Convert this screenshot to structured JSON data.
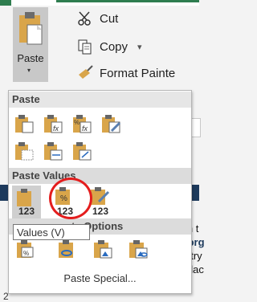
{
  "ribbon": {
    "paste_label": "Paste",
    "cut_label": "Cut",
    "copy_label": "Copy",
    "copy_caret": "▾",
    "format_painter_label": "Format Painte",
    "paste_arrow": "▾"
  },
  "background": {
    "lines": [
      "in t",
      ".org",
      "ntry",
      "ulac"
    ],
    "row_number": "2"
  },
  "menu": {
    "section_paste": "Paste",
    "section_paste_values": "Paste Values",
    "section_other": "te Options",
    "value_num": "123",
    "paste_special": "Paste Special...",
    "tooltip": "Values (V)"
  },
  "colors": {
    "accent_green": "#2e7d4f",
    "highlight_ring": "#e41d1d",
    "clipboard_tan": "#d9a54a"
  }
}
